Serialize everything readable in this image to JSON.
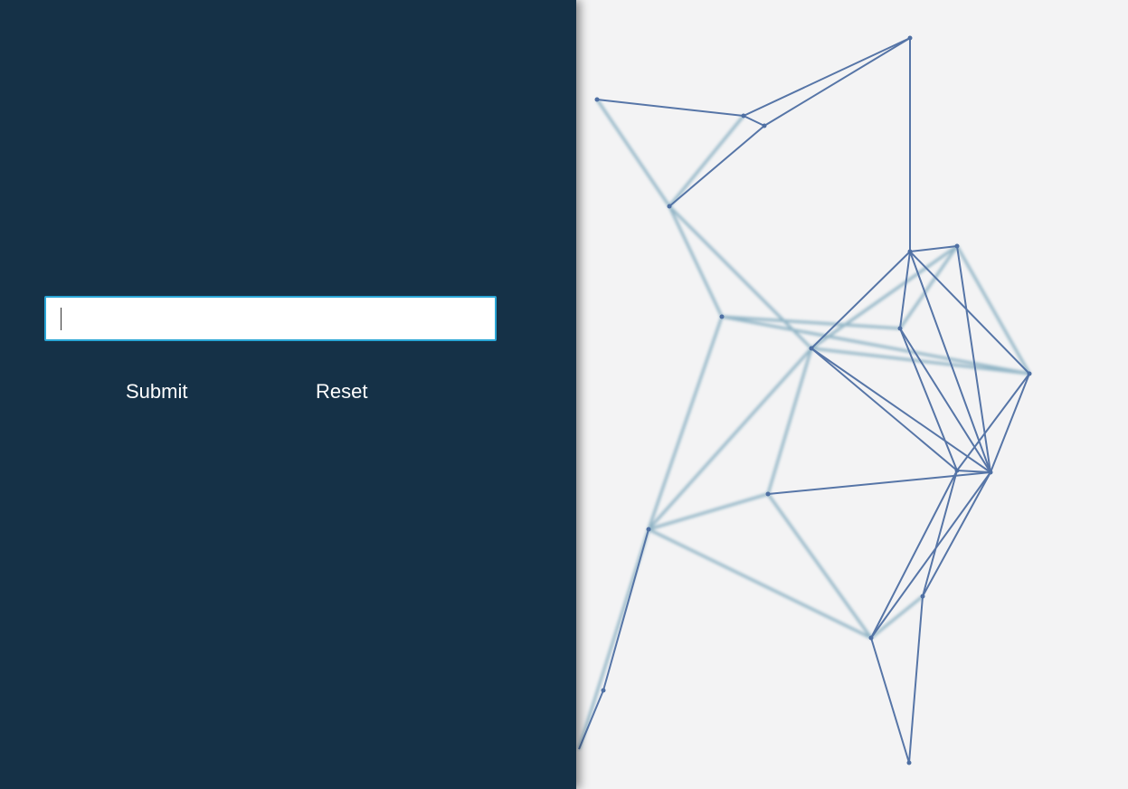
{
  "form": {
    "input_value": "",
    "input_placeholder": "",
    "submit_label": "Submit",
    "reset_label": "Reset"
  },
  "colors": {
    "panel_background": "#153147",
    "page_background": "#f3f3f4",
    "input_border": "#2aa6d6",
    "network_line": "#4e6fa3",
    "network_line_faded": "#7fa9bd"
  },
  "decoration": {
    "icon": "network-graph-icon"
  }
}
